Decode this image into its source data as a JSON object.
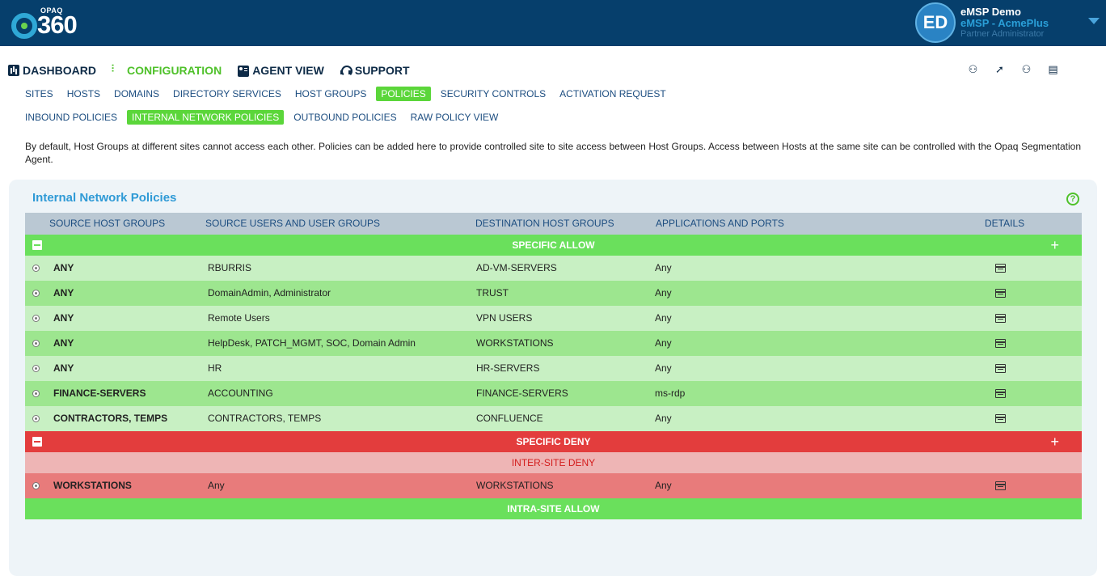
{
  "header": {
    "logo_brand": "OPAQ",
    "logo_number": "360",
    "user_initials": "ED",
    "user_name": "eMSP Demo",
    "user_org": "eMSP - AcmePlus",
    "user_role": "Partner Administrator"
  },
  "main_nav": [
    {
      "label": "DASHBOARD",
      "icon": "dashboard-icon"
    },
    {
      "label": "CONFIGURATION",
      "icon": "configuration-icon",
      "active": true
    },
    {
      "label": "AGENT VIEW",
      "icon": "agent-view-icon"
    },
    {
      "label": "SUPPORT",
      "icon": "headset-icon"
    }
  ],
  "right_icons": [
    "user-icon",
    "trend-icon",
    "users-icon",
    "document-icon"
  ],
  "sub_nav": [
    {
      "label": "SITES"
    },
    {
      "label": "HOSTS"
    },
    {
      "label": "DOMAINS"
    },
    {
      "label": "DIRECTORY SERVICES"
    },
    {
      "label": "HOST GROUPS"
    },
    {
      "label": "POLICIES",
      "active": true
    },
    {
      "label": "SECURITY CONTROLS"
    },
    {
      "label": "ACTIVATION REQUEST"
    }
  ],
  "policy_nav": [
    {
      "label": "INBOUND POLICIES"
    },
    {
      "label": "INTERNAL NETWORK POLICIES",
      "active": true
    },
    {
      "label": "OUTBOUND POLICIES"
    },
    {
      "label": "RAW POLICY VIEW"
    }
  ],
  "description": "By default, Host Groups at different sites cannot access each other. Policies can be added here to provide controlled site to site access between Host Groups. Access between Hosts at the same site can be controlled with the Opaq Segmentation Agent.",
  "panel": {
    "title": "Internal Network Policies",
    "help_symbol": "?",
    "columns": [
      "SOURCE HOST GROUPS",
      "SOURCE USERS AND USER GROUPS",
      "DESTINATION HOST GROUPS",
      "APPLICATIONS AND PORTS",
      "DETAILS"
    ],
    "allow_band": "SPECIFIC ALLOW",
    "allow_rows": [
      {
        "source": "ANY",
        "users": "RBURRIS",
        "destination": "AD-VM-SERVERS",
        "apps": "Any"
      },
      {
        "source": "ANY",
        "users": "DomainAdmin, Administrator",
        "destination": "TRUST",
        "apps": "Any"
      },
      {
        "source": "ANY",
        "users": "Remote Users",
        "destination": "VPN USERS",
        "apps": "Any"
      },
      {
        "source": "ANY",
        "users": "HelpDesk, PATCH_MGMT, SOC, Domain Admin",
        "destination": "WORKSTATIONS",
        "apps": "Any"
      },
      {
        "source": "ANY",
        "users": "HR",
        "destination": "HR-SERVERS",
        "apps": "Any"
      },
      {
        "source": "FINANCE-SERVERS",
        "users": "ACCOUNTING",
        "destination": "FINANCE-SERVERS",
        "apps": "ms-rdp"
      },
      {
        "source": "CONTRACTORS, TEMPS",
        "users": "CONTRACTORS, TEMPS",
        "destination": "CONFLUENCE",
        "apps": "Any"
      }
    ],
    "deny_band": "SPECIFIC DENY",
    "inter_site_band": "INTER-SITE DENY",
    "deny_rows": [
      {
        "source": "WORKSTATIONS",
        "users": "Any",
        "destination": "WORKSTATIONS",
        "apps": "Any"
      }
    ],
    "intra_site_band": "INTRA-SITE ALLOW",
    "add_symbol": "+"
  },
  "colors": {
    "topbar": "#063f6c",
    "accent_green": "#5bd63a",
    "deny_red": "#e33d3d",
    "link_blue": "#1c4d80"
  }
}
